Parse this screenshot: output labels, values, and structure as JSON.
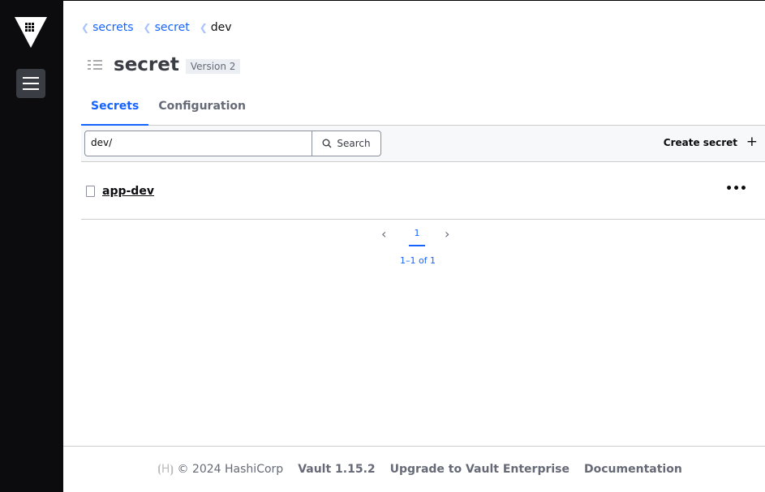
{
  "breadcrumbs": [
    {
      "label": "secrets"
    },
    {
      "label": "secret"
    },
    {
      "label": "dev"
    }
  ],
  "header": {
    "title": "secret",
    "version_badge": "Version 2"
  },
  "tabs": [
    {
      "label": "Secrets",
      "active": true
    },
    {
      "label": "Configuration",
      "active": false
    }
  ],
  "toolbar": {
    "filter_value": "dev/",
    "search_label": "Search",
    "create_label": "Create secret"
  },
  "secrets": [
    {
      "name": "app-dev"
    }
  ],
  "pagination": {
    "current_page": "1",
    "summary": "1–1 of 1"
  },
  "footer": {
    "copyright": "© 2024 HashiCorp",
    "version": "Vault 1.15.2",
    "upgrade": "Upgrade to Vault Enterprise",
    "docs": "Documentation"
  },
  "colors": {
    "accent": "#1563ff",
    "sidebar": "#0c0c0e"
  }
}
